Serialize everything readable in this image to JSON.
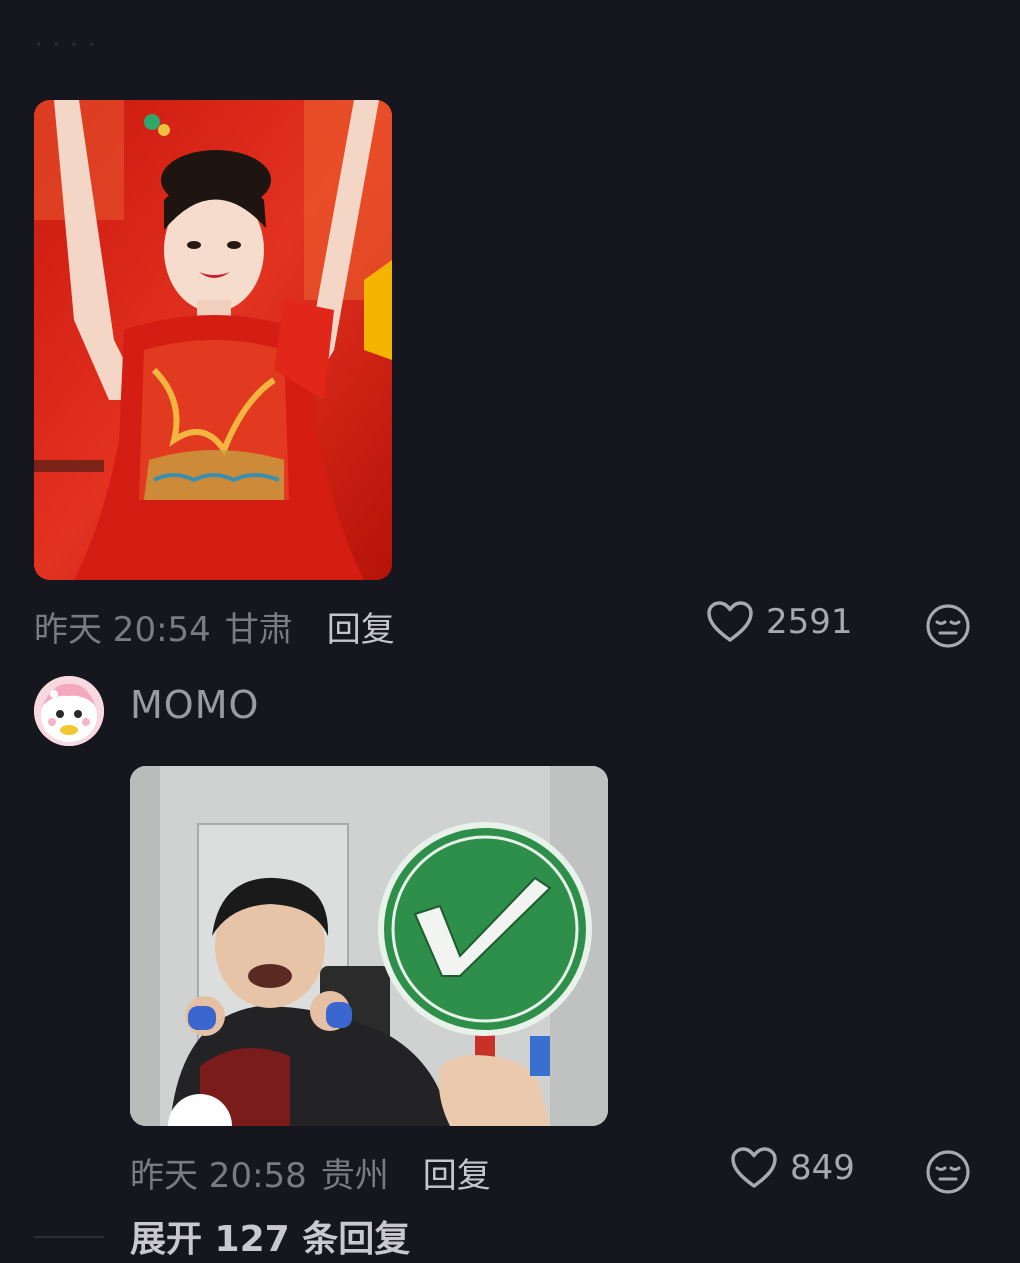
{
  "comments": [
    {
      "time": "昨天 20:54",
      "location": "甘肃",
      "reply_label": "回复",
      "likes": "2591"
    },
    {
      "username": "MOMO",
      "time": "昨天 20:58",
      "location": "贵州",
      "reply_label": "回复",
      "likes": "849"
    }
  ],
  "expand_replies": "展开 127 条回复",
  "icons": {
    "like": "heart-outline-icon",
    "dislike": "meh-face-icon"
  },
  "colors": {
    "background": "#16161e",
    "meta_text": "#7a7a82",
    "dress_red": "#d8261b",
    "sign_green": "#2e8f4a"
  }
}
